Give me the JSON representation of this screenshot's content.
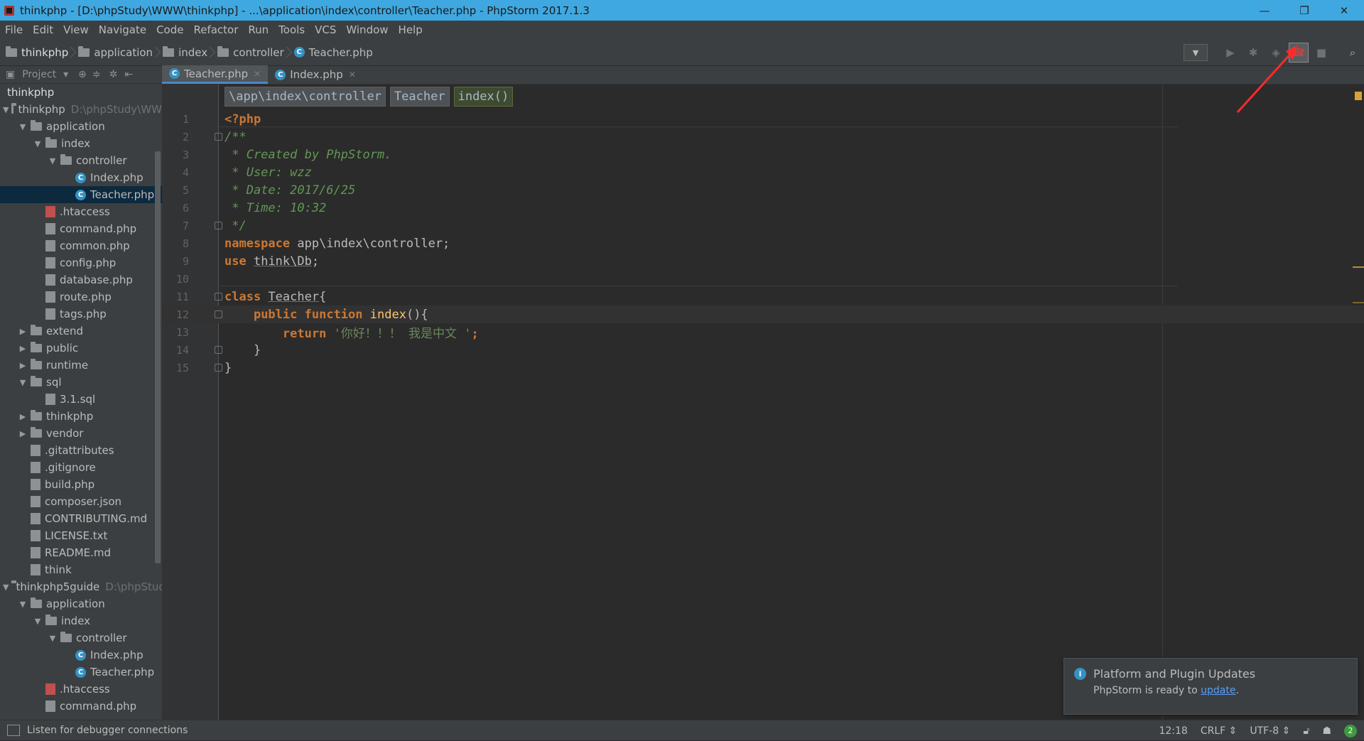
{
  "window": {
    "title": "thinkphp - [D:\\phpStudy\\WWW\\thinkphp] - ...\\application\\index\\controller\\Teacher.php - PhpStorm 2017.1.3",
    "minimize": "—",
    "restore": "❐",
    "close": "✕"
  },
  "menu": [
    "File",
    "Edit",
    "View",
    "Navigate",
    "Code",
    "Refactor",
    "Run",
    "Tools",
    "VCS",
    "Window",
    "Help"
  ],
  "breadcrumbs": [
    "thinkphp",
    "application",
    "index",
    "controller",
    "Teacher.php"
  ],
  "project_panel": {
    "label": "Project",
    "tree": [
      {
        "label": "thinkphp",
        "path": "",
        "depth": 0,
        "type": "root",
        "arrow": ""
      },
      {
        "label": "thinkphp",
        "path": "D:\\phpStudy\\WW",
        "depth": 0,
        "type": "folder",
        "arrow": "▼"
      },
      {
        "label": "application",
        "path": "",
        "depth": 1,
        "type": "folder",
        "arrow": "▼"
      },
      {
        "label": "index",
        "path": "",
        "depth": 2,
        "type": "folder",
        "arrow": "▼"
      },
      {
        "label": "controller",
        "path": "",
        "depth": 3,
        "type": "folder",
        "arrow": "▼"
      },
      {
        "label": "Index.php",
        "path": "",
        "depth": 4,
        "type": "class",
        "arrow": ""
      },
      {
        "label": "Teacher.php",
        "path": "",
        "depth": 4,
        "type": "class",
        "arrow": "",
        "selected": true
      },
      {
        "label": ".htaccess",
        "path": "",
        "depth": 2,
        "type": "htaccess",
        "arrow": ""
      },
      {
        "label": "command.php",
        "path": "",
        "depth": 2,
        "type": "php",
        "arrow": ""
      },
      {
        "label": "common.php",
        "path": "",
        "depth": 2,
        "type": "php",
        "arrow": ""
      },
      {
        "label": "config.php",
        "path": "",
        "depth": 2,
        "type": "php",
        "arrow": ""
      },
      {
        "label": "database.php",
        "path": "",
        "depth": 2,
        "type": "php",
        "arrow": ""
      },
      {
        "label": "route.php",
        "path": "",
        "depth": 2,
        "type": "php",
        "arrow": ""
      },
      {
        "label": "tags.php",
        "path": "",
        "depth": 2,
        "type": "php",
        "arrow": ""
      },
      {
        "label": "extend",
        "path": "",
        "depth": 1,
        "type": "folder",
        "arrow": "▶"
      },
      {
        "label": "public",
        "path": "",
        "depth": 1,
        "type": "folder",
        "arrow": "▶"
      },
      {
        "label": "runtime",
        "path": "",
        "depth": 1,
        "type": "folder",
        "arrow": "▶"
      },
      {
        "label": "sql",
        "path": "",
        "depth": 1,
        "type": "folder",
        "arrow": "▼"
      },
      {
        "label": "3.1.sql",
        "path": "",
        "depth": 2,
        "type": "sql",
        "arrow": ""
      },
      {
        "label": "thinkphp",
        "path": "",
        "depth": 1,
        "type": "folder",
        "arrow": "▶"
      },
      {
        "label": "vendor",
        "path": "",
        "depth": 1,
        "type": "folder",
        "arrow": "▶"
      },
      {
        "label": ".gitattributes",
        "path": "",
        "depth": 1,
        "type": "file",
        "arrow": ""
      },
      {
        "label": ".gitignore",
        "path": "",
        "depth": 1,
        "type": "file",
        "arrow": ""
      },
      {
        "label": "build.php",
        "path": "",
        "depth": 1,
        "type": "php",
        "arrow": ""
      },
      {
        "label": "composer.json",
        "path": "",
        "depth": 1,
        "type": "json",
        "arrow": ""
      },
      {
        "label": "CONTRIBUTING.md",
        "path": "",
        "depth": 1,
        "type": "md",
        "arrow": ""
      },
      {
        "label": "LICENSE.txt",
        "path": "",
        "depth": 1,
        "type": "file",
        "arrow": ""
      },
      {
        "label": "README.md",
        "path": "",
        "depth": 1,
        "type": "md",
        "arrow": ""
      },
      {
        "label": "think",
        "path": "",
        "depth": 1,
        "type": "file",
        "arrow": ""
      },
      {
        "label": "thinkphp5guide",
        "path": "D:\\phpStud",
        "depth": 0,
        "type": "folder",
        "arrow": "▼"
      },
      {
        "label": "application",
        "path": "",
        "depth": 1,
        "type": "folder",
        "arrow": "▼"
      },
      {
        "label": "index",
        "path": "",
        "depth": 2,
        "type": "folder",
        "arrow": "▼"
      },
      {
        "label": "controller",
        "path": "",
        "depth": 3,
        "type": "folder",
        "arrow": "▼"
      },
      {
        "label": "Index.php",
        "path": "",
        "depth": 4,
        "type": "class",
        "arrow": ""
      },
      {
        "label": "Teacher.php",
        "path": "",
        "depth": 4,
        "type": "class",
        "arrow": ""
      },
      {
        "label": ".htaccess",
        "path": "",
        "depth": 2,
        "type": "htaccess",
        "arrow": ""
      },
      {
        "label": "command.php",
        "path": "",
        "depth": 2,
        "type": "php",
        "arrow": ""
      }
    ]
  },
  "tabs": [
    {
      "label": "Teacher.php",
      "active": true
    },
    {
      "label": "Index.php",
      "active": false
    }
  ],
  "editor": {
    "breadcrumb": [
      "\\app\\index\\controller",
      "Teacher",
      "index()"
    ],
    "lines": [
      {
        "n": "1",
        "tokens": [
          {
            "t": "<?php",
            "c": "tag"
          }
        ]
      },
      {
        "n": "2",
        "tokens": [
          {
            "t": "/**",
            "c": "cm"
          }
        ]
      },
      {
        "n": "3",
        "tokens": [
          {
            "t": " * Created by PhpStorm.",
            "c": "cm"
          }
        ]
      },
      {
        "n": "4",
        "tokens": [
          {
            "t": " * User: wzz",
            "c": "cm"
          }
        ]
      },
      {
        "n": "5",
        "tokens": [
          {
            "t": " * Date: 2017/6/25",
            "c": "cm"
          }
        ]
      },
      {
        "n": "6",
        "tokens": [
          {
            "t": " * Time: 10:32",
            "c": "cm"
          }
        ]
      },
      {
        "n": "7",
        "tokens": [
          {
            "t": " */",
            "c": "cm"
          }
        ]
      },
      {
        "n": "8",
        "tokens": [
          {
            "t": "namespace",
            "c": "kw"
          },
          {
            "t": " app\\index\\controller;",
            "c": ""
          }
        ]
      },
      {
        "n": "9",
        "tokens": [
          {
            "t": "use",
            "c": "kw"
          },
          {
            "t": " ",
            "c": ""
          },
          {
            "t": "think\\Db",
            "c": "und"
          },
          {
            "t": ";",
            "c": ""
          }
        ]
      },
      {
        "n": "10",
        "tokens": []
      },
      {
        "n": "11",
        "tokens": [
          {
            "t": "class",
            "c": "kw"
          },
          {
            "t": " ",
            "c": ""
          },
          {
            "t": "Teacher",
            "c": "und"
          },
          {
            "t": "{",
            "c": ""
          }
        ]
      },
      {
        "n": "12",
        "tokens": [
          {
            "t": "    ",
            "c": ""
          },
          {
            "t": "public",
            "c": "kw"
          },
          {
            "t": " ",
            "c": ""
          },
          {
            "t": "function",
            "c": "kw"
          },
          {
            "t": " ",
            "c": ""
          },
          {
            "t": "index",
            "c": "fn"
          },
          {
            "t": "(){",
            "c": ""
          }
        ],
        "current": true
      },
      {
        "n": "13",
        "tokens": [
          {
            "t": "        ",
            "c": ""
          },
          {
            "t": "return",
            "c": "kw"
          },
          {
            "t": " ",
            "c": ""
          },
          {
            "t": "'你好！！！ 我是中文 '",
            "c": "str"
          },
          {
            "t": ";",
            "c": "kw"
          }
        ]
      },
      {
        "n": "14",
        "tokens": [
          {
            "t": "    }",
            "c": ""
          }
        ]
      },
      {
        "n": "15",
        "tokens": [
          {
            "t": "}",
            "c": ""
          }
        ]
      }
    ]
  },
  "notification": {
    "title": "Platform and Plugin Updates",
    "body": "PhpStorm is ready to ",
    "link": "update",
    "suffix": "."
  },
  "statusbar": {
    "message": "Listen for debugger connections",
    "position": "12:18",
    "line_sep": "CRLF",
    "encoding": "UTF-8",
    "badge": "2"
  },
  "colors": {
    "titlebar": "#40a8e0",
    "editor_bg": "#2b2b2b",
    "panel_bg": "#3c3f41",
    "keyword": "#cc7832",
    "comment": "#629755",
    "string": "#6a8759",
    "function": "#ffc66d",
    "annotation_arrow": "#ff2a2a"
  }
}
